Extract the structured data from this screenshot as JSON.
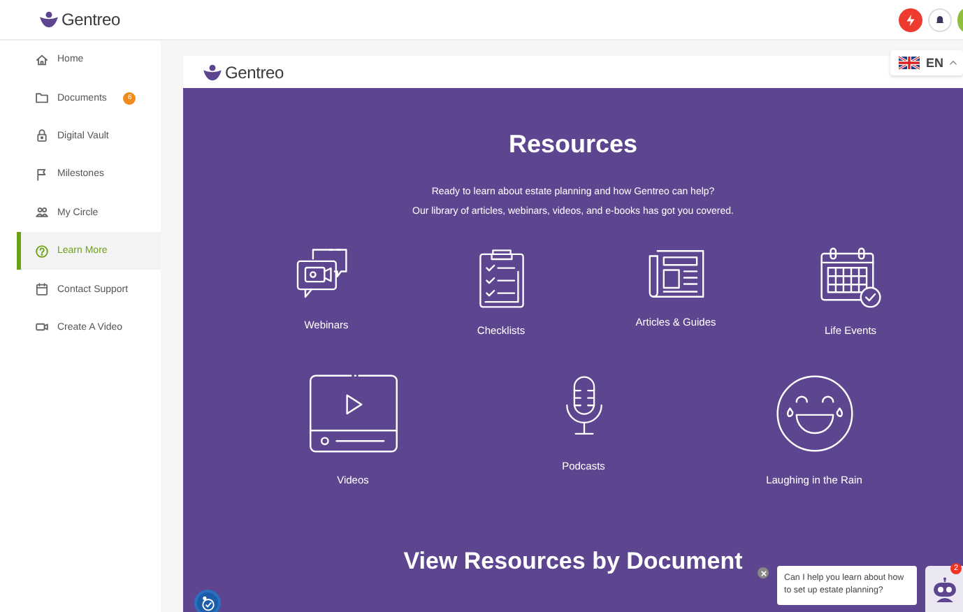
{
  "app": {
    "logo": "Gentreo"
  },
  "sidebar": {
    "items": [
      {
        "label": "Home",
        "kind": "home",
        "selected": false
      },
      {
        "label": "Documents",
        "kind": "folder",
        "badge": "6",
        "selected": false
      },
      {
        "label": "Digital Vault",
        "kind": "lock",
        "selected": false
      },
      {
        "label": "Milestones",
        "kind": "flag",
        "selected": false
      },
      {
        "label": "My Circle",
        "kind": "people",
        "selected": false
      },
      {
        "label": "Learn More",
        "kind": "question",
        "selected": true
      },
      {
        "label": "Contact Support",
        "kind": "calendar",
        "selected": false
      },
      {
        "label": "Create A Video",
        "kind": "camera",
        "selected": false
      }
    ]
  },
  "language": {
    "code": "EN"
  },
  "page": {
    "logo": "Gentreo",
    "title": "Resources",
    "intro": [
      "Ready to learn about estate planning and how Gentreo can help?",
      "Our library of articles, webinars, videos, and e-books has got you covered."
    ],
    "category_rows": [
      [
        {
          "label": "Webinars",
          "kind": "webinar"
        },
        {
          "label": "Checklists",
          "kind": "checklist"
        },
        {
          "label": "Articles & Guides",
          "kind": "newspaper"
        },
        {
          "label": "Life Events",
          "kind": "calendar"
        }
      ],
      [
        {
          "label": "Videos",
          "kind": "video"
        },
        {
          "label": "Podcasts",
          "kind": "microphone"
        },
        {
          "label": "Laughing in the Rain",
          "kind": "laughing"
        }
      ]
    ],
    "section_title": "View Resources by Document"
  },
  "chat": {
    "message": "Can I help you learn about how to set up estate planning?",
    "unread": "2"
  }
}
